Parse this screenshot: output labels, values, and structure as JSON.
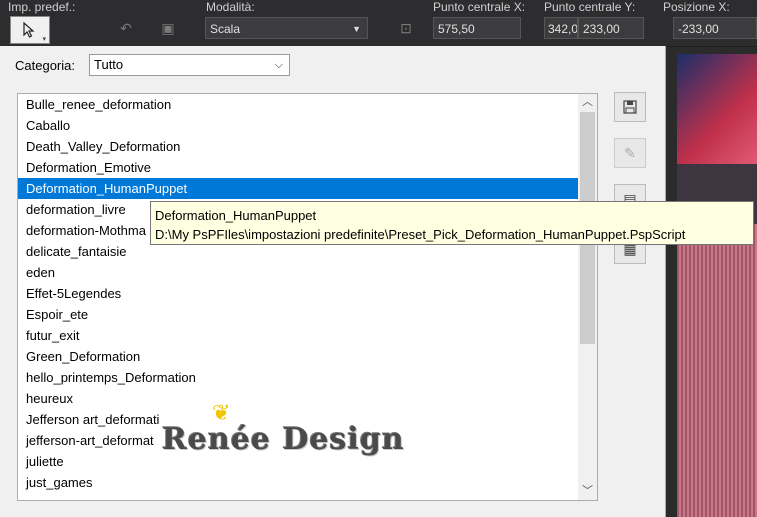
{
  "toolbar": {
    "preset_label": "Imp. predef.:",
    "mode_label": "Modalità:",
    "mode_value": "Scala",
    "center_x_label": "Punto centrale X:",
    "center_x_value": "575,50",
    "center_y_label": "Punto centrale Y:",
    "center_y_partial": "342,0",
    "center_y_value": "233,00",
    "pos_x_label": "Posizione X:",
    "pos_x_value": "-233,00"
  },
  "dialog": {
    "category_label": "Categoria:",
    "category_value": "Tutto",
    "items": [
      {
        "label": "Bulle_renee_deformation"
      },
      {
        "label": "Caballo"
      },
      {
        "label": "Death_Valley_Deformation"
      },
      {
        "label": "Deformation_Emotive"
      },
      {
        "label": "Deformation_HumanPuppet"
      },
      {
        "label": "deformation_livre"
      },
      {
        "label": "deformation-Mothma"
      },
      {
        "label": "delicate_fantaisie"
      },
      {
        "label": "eden"
      },
      {
        "label": "Effet-5Legendes"
      },
      {
        "label": "Espoir_ete"
      },
      {
        "label": "futur_exit"
      },
      {
        "label": "Green_Deformation"
      },
      {
        "label": "hello_printemps_Deformation"
      },
      {
        "label": "heureux"
      },
      {
        "label": "Jefferson art_deformati"
      },
      {
        "label": "jefferson-art_deformat"
      },
      {
        "label": "juliette"
      },
      {
        "label": "just_games"
      }
    ],
    "tooltip_title": "Deformation_HumanPuppet",
    "tooltip_path": "D:\\My PsPFIles\\impostazioni predefinite\\Preset_Pick_Deformation_HumanPuppet.PspScript"
  },
  "watermark": {
    "text": "Renée Design"
  },
  "colors": {
    "selection": "#0078d7",
    "tooltip_bg": "#ffffe1"
  }
}
